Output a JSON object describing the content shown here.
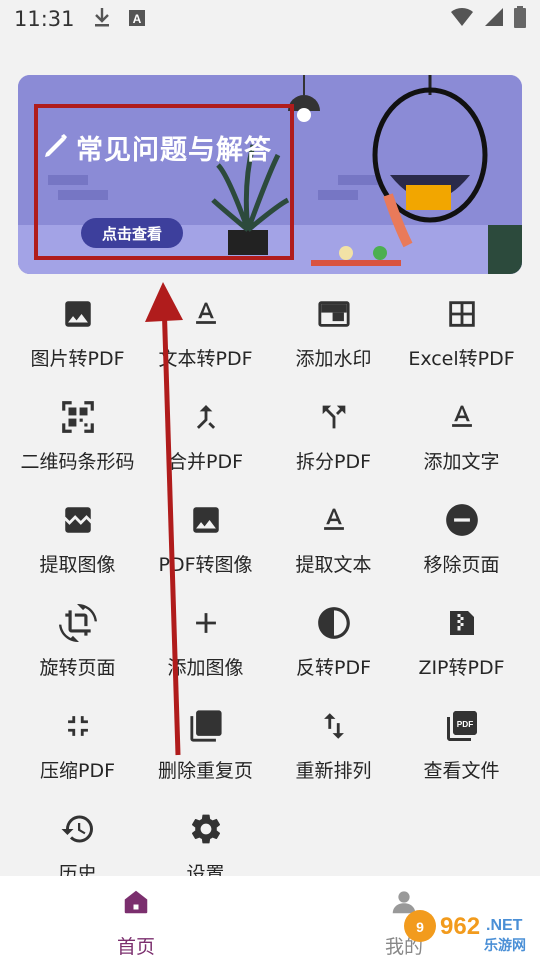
{
  "status_bar": {
    "time": "11:31"
  },
  "banner": {
    "title": "常见问题与解答",
    "button_label": "点击查看"
  },
  "tools": [
    {
      "label": "图片转PDF",
      "icon": "image-icon"
    },
    {
      "label": "文本转PDF",
      "icon": "text-format-icon"
    },
    {
      "label": "添加水印",
      "icon": "watermark-icon"
    },
    {
      "label": "Excel转PDF",
      "icon": "grid-icon"
    },
    {
      "label": "二维码条形码",
      "icon": "qr-code-icon"
    },
    {
      "label": "合并PDF",
      "icon": "merge-icon"
    },
    {
      "label": "拆分PDF",
      "icon": "split-icon"
    },
    {
      "label": "添加文字",
      "icon": "text-format-icon"
    },
    {
      "label": "提取图像",
      "icon": "image-extract-icon"
    },
    {
      "label": "PDF转图像",
      "icon": "image-icon"
    },
    {
      "label": "提取文本",
      "icon": "text-format-icon"
    },
    {
      "label": "移除页面",
      "icon": "remove-circle-icon"
    },
    {
      "label": "旋转页面",
      "icon": "rotate-icon"
    },
    {
      "label": "添加图像",
      "icon": "plus-icon"
    },
    {
      "label": "反转PDF",
      "icon": "invert-icon"
    },
    {
      "label": "ZIP转PDF",
      "icon": "zip-icon"
    },
    {
      "label": "压缩PDF",
      "icon": "compress-icon"
    },
    {
      "label": "删除重复页",
      "icon": "duplicate-pages-icon"
    },
    {
      "label": "重新排列",
      "icon": "reorder-icon"
    },
    {
      "label": "查看文件",
      "icon": "pdf-file-icon"
    },
    {
      "label": "历史",
      "icon": "history-icon"
    },
    {
      "label": "设置",
      "icon": "gear-icon"
    }
  ],
  "nav": {
    "home_label": "首页",
    "mine_label": "我的"
  },
  "watermark": {
    "text": "962.NET",
    "subtext": "乐游网"
  },
  "colors": {
    "accent": "#7b2f6e",
    "banner": "#8b8bd6",
    "annotation": "#b01c1c"
  }
}
